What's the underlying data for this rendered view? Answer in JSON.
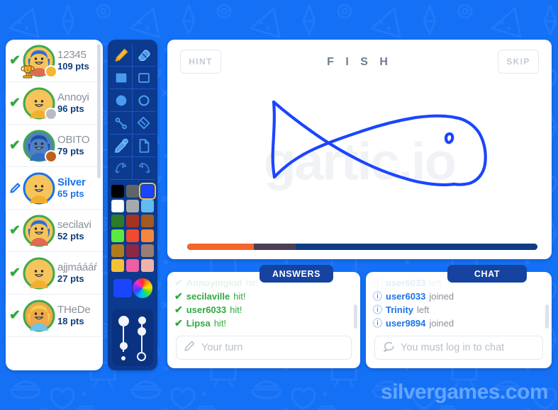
{
  "brand": {
    "text": "silvergames.com",
    "color": "#64a6ff"
  },
  "background": {
    "color": "#1470f5",
    "doodle_color": "#2b7dfa"
  },
  "players": {
    "scroll_visible": true,
    "items": [
      {
        "name": "12345",
        "points": "109 pts",
        "status": "check",
        "coin": "#f5b731",
        "trophy": true,
        "skin": "#f6c45a",
        "hair": "#2b6fd6",
        "shirt": "#e06a52",
        "ring": "#3fa94b",
        "drawer": false
      },
      {
        "name": "Annoyi",
        "points": "96 pts",
        "status": "check",
        "coin": "#b7bcc3",
        "trophy": false,
        "skin": "#f6c45a",
        "hair": "none",
        "shirt": "#f0b02e",
        "ring": "#3fa94b",
        "drawer": false
      },
      {
        "name": "OBITO",
        "points": "79 pts",
        "status": "check",
        "coin": "#c0601e",
        "trophy": false,
        "skin": "#4f7fc4",
        "hair": "#1d4f9c",
        "shirt": "#2f6fc2",
        "ring": "#3fa94b",
        "drawer": false
      },
      {
        "name": "Silver",
        "points": "65 pts",
        "status": "pencil",
        "coin": "none",
        "trophy": false,
        "skin": "#f6c45a",
        "hair": "none",
        "shirt": "#f0b02e",
        "ring": "#1a73e8",
        "drawer": true
      },
      {
        "name": "secilavi",
        "points": "52 pts",
        "status": "check",
        "coin": "none",
        "trophy": false,
        "skin": "#f6c45a",
        "hair": "#2b6fd6",
        "shirt": "#e06a52",
        "ring": "#3fa94b",
        "drawer": false
      },
      {
        "name": "ajjmáááŕ",
        "points": "27 pts",
        "status": "check",
        "coin": "none",
        "trophy": false,
        "skin": "#f6c45a",
        "hair": "none",
        "shirt": "#f0b02e",
        "ring": "#3fa94b",
        "drawer": false
      },
      {
        "name": "THeDe",
        "points": "18 pts",
        "status": "check",
        "coin": "none",
        "trophy": false,
        "skin": "#f0a84a",
        "hair": "#f2d14a",
        "shirt": "#6fc4e8",
        "ring": "#3fa94b",
        "drawer": false
      }
    ]
  },
  "toolbar": {
    "tools": [
      {
        "name": "pencil-tool",
        "selected": true
      },
      {
        "name": "eraser-tool",
        "selected": false
      },
      {
        "name": "filled-rectangle-tool",
        "selected": false
      },
      {
        "name": "outline-rectangle-tool",
        "selected": false
      },
      {
        "name": "filled-ellipse-tool",
        "selected": false
      },
      {
        "name": "outline-ellipse-tool",
        "selected": false
      },
      {
        "name": "line-tool",
        "selected": false
      },
      {
        "name": "fill-tool",
        "selected": false
      },
      {
        "name": "eyedropper-tool",
        "selected": false
      },
      {
        "name": "new-page-tool",
        "selected": false
      },
      {
        "name": "undo-tool",
        "selected": false
      },
      {
        "name": "redo-tool",
        "selected": false
      }
    ],
    "palette": [
      "#000000",
      "#616567",
      "#1a45ff",
      "#ffffff",
      "#a7aaad",
      "#61bcf0",
      "#2c7b27",
      "#a83221",
      "#a35a22",
      "#5ce83e",
      "#f04a2e",
      "#f4873c",
      "#b07a1e",
      "#8e2744",
      "#9a7d74",
      "#f5c236",
      "#ee5ea0",
      "#f0b3a8"
    ],
    "selected_swatch_index": 2,
    "current_color": "#1a45ff",
    "color_wheel": "color-wheel",
    "sliders": [
      {
        "name": "brush-size-slider",
        "value_top": "large",
        "value_bottom": "small"
      },
      {
        "name": "brush-opacity-slider",
        "value_top": "solid",
        "value_bottom": "hollow"
      }
    ]
  },
  "canvas": {
    "hint_label": "HINT",
    "skip_label": "SKIP",
    "word": "F I S H",
    "word_plain": "FISH",
    "watermark": "gartic.io",
    "drawing_color": "#1a45ff",
    "drawing_subject": "fish",
    "progress": {
      "segments": [
        {
          "name": "elapsed-orange",
          "color": "#f4652b",
          "pct": 19
        },
        {
          "name": "elapsed-dim",
          "color": "#4a3f57",
          "pct": 12
        },
        {
          "name": "remaining",
          "color": "#0f3b86",
          "pct": 69
        }
      ]
    }
  },
  "answers": {
    "tab_label": "ANSWERS",
    "messages": [
      {
        "who": "Annoyingkid",
        "act": "hit!",
        "faded": true
      },
      {
        "who": "secilaville",
        "act": "hit!",
        "faded": false
      },
      {
        "who": "user6033",
        "act": "hit!",
        "faded": false
      },
      {
        "who": "Lipsa",
        "act": "hit!",
        "faded": false
      }
    ],
    "input_placeholder": "Your turn",
    "input_value": "",
    "input_icon": "pencil-icon"
  },
  "chat": {
    "tab_label": "CHAT",
    "messages": [
      {
        "who": "user6033",
        "act": "left",
        "faded": true
      },
      {
        "who": "user6033",
        "act": "joined",
        "faded": false
      },
      {
        "who": "Trinity",
        "act": "left",
        "faded": false
      },
      {
        "who": "user9894",
        "act": "joined",
        "faded": false
      }
    ],
    "input_placeholder": "You must log in to chat",
    "input_value": "",
    "input_icon": "chat-bubble-icon"
  }
}
